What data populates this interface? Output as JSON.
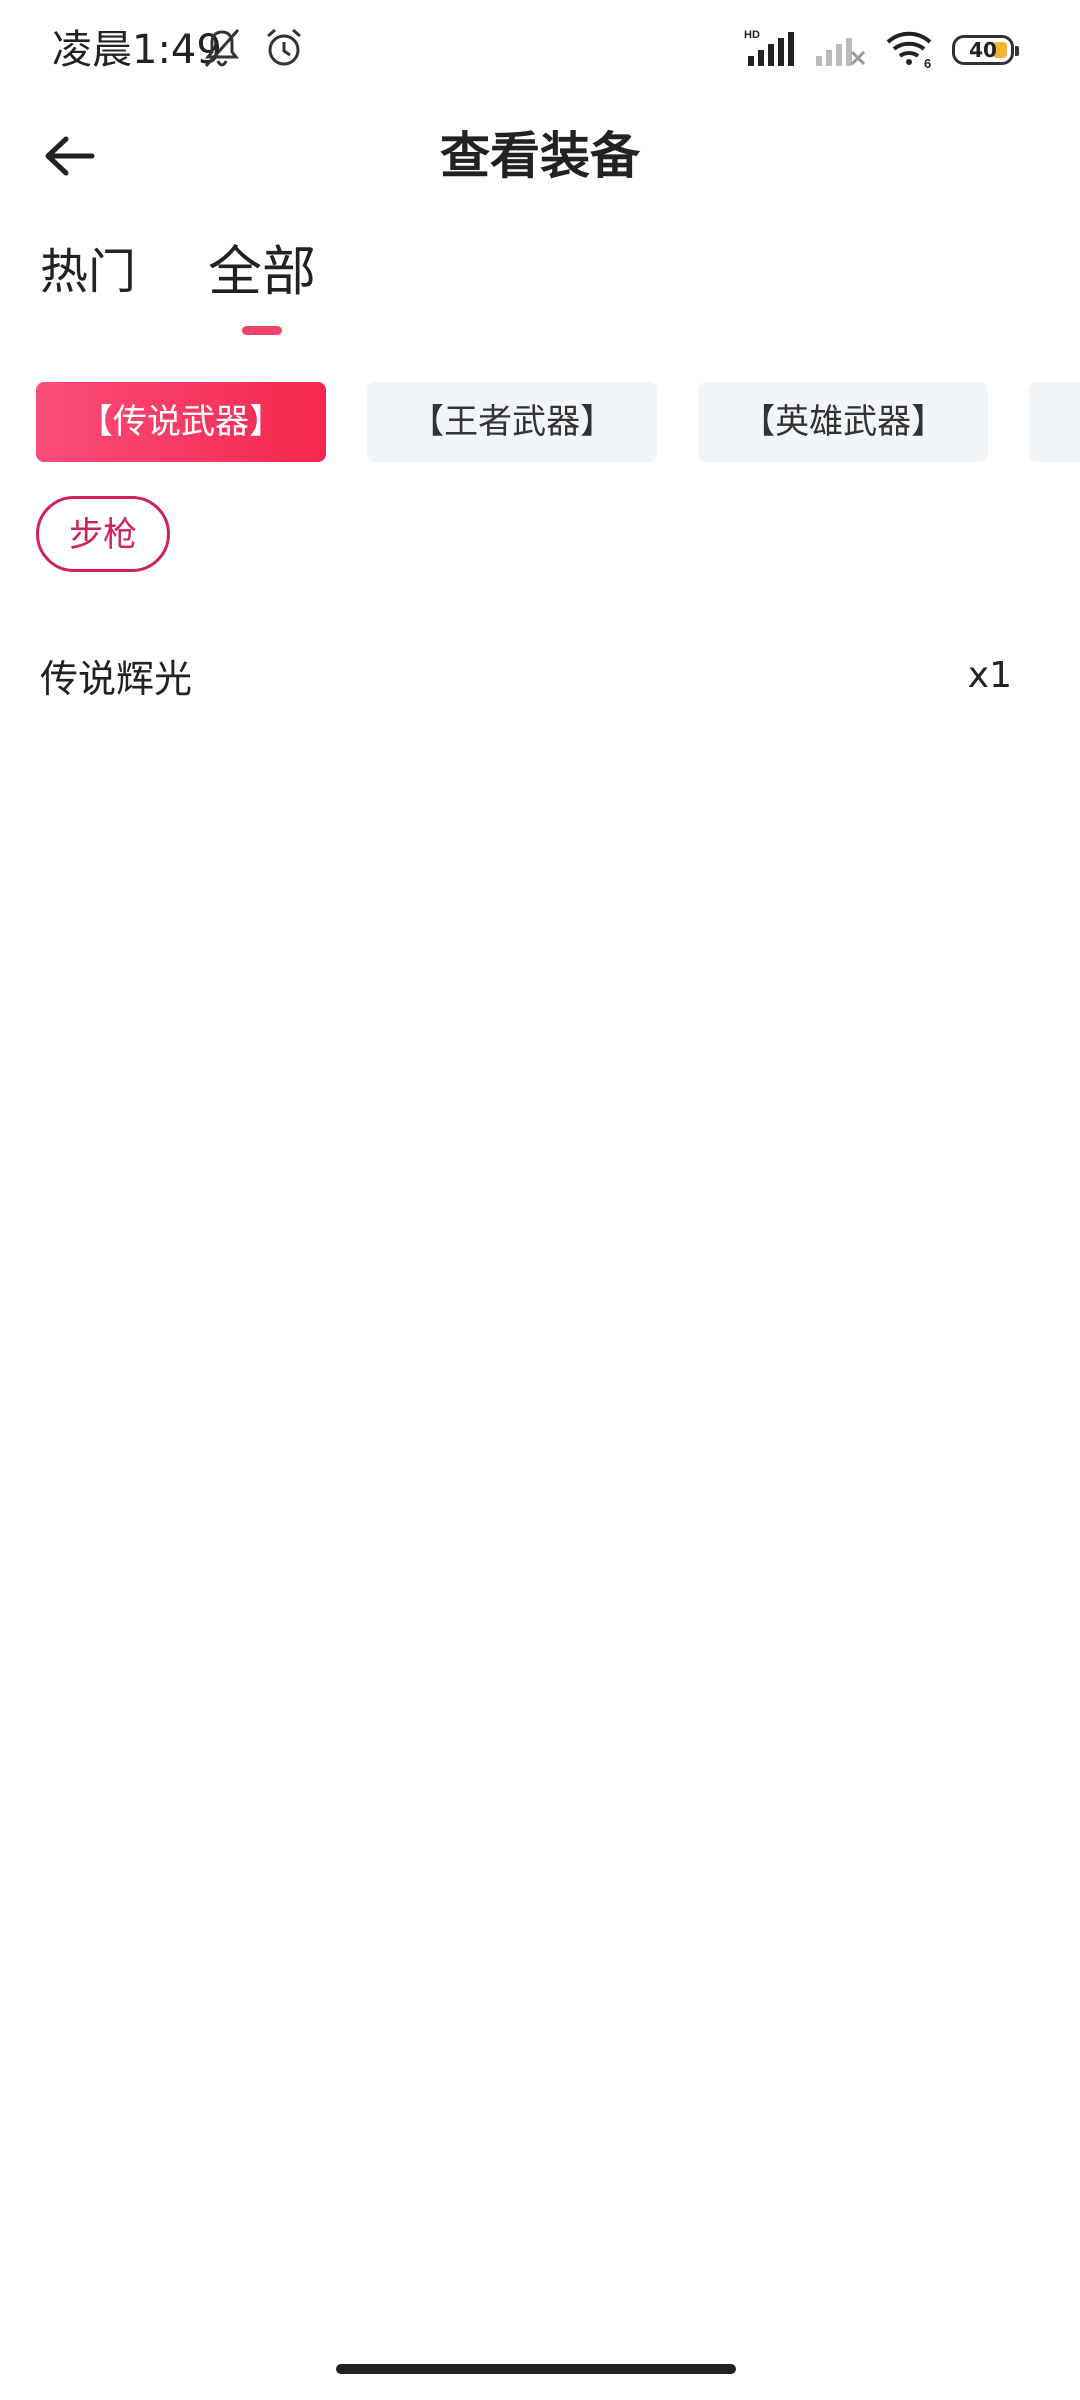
{
  "status_bar": {
    "time": "凌晨1:49",
    "battery": "40",
    "icons": [
      "mute-bell-icon",
      "alarm-icon",
      "hd-signal-icon",
      "signal-off-icon",
      "wifi-icon",
      "battery-icon"
    ]
  },
  "header": {
    "back_icon": "arrow-left-icon",
    "title": "查看装备"
  },
  "tabs": [
    {
      "label": "热门",
      "active": false
    },
    {
      "label": "全部",
      "active": true
    }
  ],
  "categories": [
    {
      "label": "【传说武器】",
      "active": true
    },
    {
      "label": "【王者武器】",
      "active": false
    },
    {
      "label": "【英雄武器】",
      "active": false
    },
    {
      "label": "【",
      "active": false
    }
  ],
  "subcategories": [
    {
      "label": "步枪",
      "active": true
    }
  ],
  "items": [
    {
      "name": "传说辉光",
      "count": "x1"
    }
  ],
  "colors": {
    "accent": "#f2436a",
    "pill_border": "#cf2357",
    "chip_bg": "#f3f6f8"
  }
}
